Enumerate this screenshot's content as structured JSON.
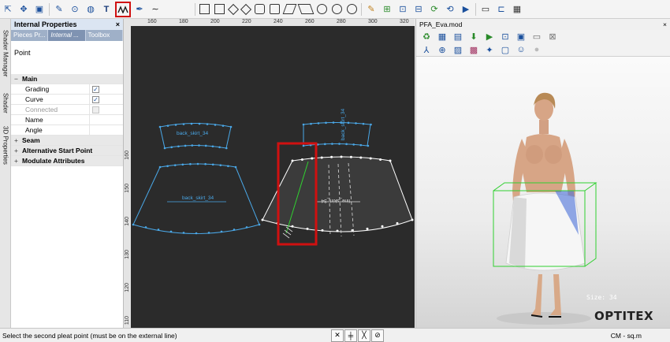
{
  "toolbar": {
    "icons": [
      "select-arrow-icon",
      "point-tool-icon",
      "image-tool-icon",
      "pencil-icon",
      "target-icon",
      "globe-icon",
      "text-tool-icon",
      "pleat-tool-icon",
      "pen-icon",
      "curve-tool-icon"
    ],
    "highlighted_icon": "pleat-tool-icon",
    "text_tool_glyph": "T",
    "curve_glyph": "∼",
    "shape_icons": [
      "square-icon",
      "square-outline-icon",
      "diamond-icon",
      "diamond-small-icon",
      "hexagon-icon",
      "pentagon-icon",
      "rhombus-icon",
      "parallelogram-icon",
      "circle-icon",
      "circle-large-icon",
      "circle-small-icon"
    ],
    "right_icons": [
      "pencil-edit-icon",
      "layout-icon",
      "piece-icon",
      "measure-icon",
      "refresh-icon",
      "contour-icon",
      "play-icon",
      "window-icon",
      "scroll-icon"
    ]
  },
  "side_tabs": [
    "Shader Manager",
    "Shader",
    "3D Properties"
  ],
  "properties_panel": {
    "title": "Internal Properties",
    "close": "×",
    "tabs": [
      "Pieces Pr...",
      "Internal ...",
      "Toolbox"
    ],
    "active_tab": 1,
    "subject": "Point",
    "rows": [
      {
        "type": "cat",
        "label": "Main",
        "toggle": "−"
      },
      {
        "type": "prop",
        "label": "Grading",
        "check": true,
        "disabled": false
      },
      {
        "type": "prop",
        "label": "Curve",
        "check": true,
        "disabled": false
      },
      {
        "type": "prop",
        "label": "Connected",
        "check": false,
        "disabled": true
      },
      {
        "type": "prop",
        "label": "Name",
        "value": ""
      },
      {
        "type": "prop",
        "label": "Angle",
        "value": ""
      },
      {
        "type": "cat",
        "label": "Seam",
        "toggle": "+"
      },
      {
        "type": "cat",
        "label": "Alternative Start Point",
        "toggle": "+"
      },
      {
        "type": "cat",
        "label": "Modulate Attributes",
        "toggle": "+"
      }
    ]
  },
  "ruler": {
    "top": [
      "160",
      "180",
      "200",
      "220",
      "240",
      "260",
      "280",
      "300",
      "320"
    ],
    "left": [
      "160",
      "150",
      "140",
      "130",
      "120",
      "110"
    ]
  },
  "canvas": {
    "piece_labels": {
      "back_waist": "back_skirt_34",
      "back": "back_skirt_34",
      "front_waist": "back_skirt_34",
      "front": "line_skirt_34"
    },
    "colors": {
      "background": "#2b2b2b",
      "piece": "#4aa8e8",
      "selected_piece": "#ffffff",
      "highlight": "#d01010",
      "pleat_line": "#30d030"
    }
  },
  "viewer": {
    "title": "PFA_Eva.mod",
    "close": "×",
    "size_label": "Size: 34",
    "logo": "OPTITEX"
  },
  "status": {
    "message": "Select the second pleat point (must be on the external line)",
    "units": "CM - sq.m",
    "snap_icons": [
      "snap-point-icon",
      "snap-mid-icon",
      "snap-line-icon",
      "snap-end-icon"
    ]
  }
}
